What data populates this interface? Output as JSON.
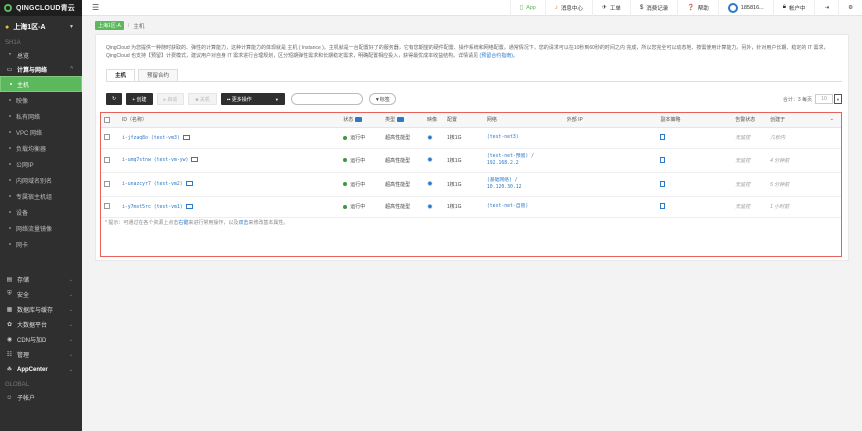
{
  "brand": {
    "logo_text": "QINGCLOUD青云"
  },
  "sidebar": {
    "zone_label": "上海1区-A",
    "section_label": "SH1A",
    "global_label": "GLOBAL",
    "items_top": [
      {
        "label": "总览",
        "icon": "dashboard-icon",
        "glyph": "◔"
      },
      {
        "label": "计算与网络",
        "icon": "computer-icon",
        "glyph": "▭"
      }
    ],
    "sub_items": [
      "主机",
      "映像",
      "私有网络",
      "VPC 网络",
      "负载均衡器",
      "公网IP",
      "内网域名别名",
      "专属宿主机组",
      "设备",
      "网络流量镜像",
      "网卡"
    ],
    "items_bottom": [
      {
        "label": "存储",
        "icon": "storage-icon",
        "glyph": "▤"
      },
      {
        "label": "安全",
        "icon": "security-icon",
        "glyph": "⛨"
      },
      {
        "label": "数据库与缓存",
        "icon": "database-icon",
        "glyph": "▦"
      },
      {
        "label": "大数据平台",
        "icon": "bigdata-icon",
        "glyph": "✿"
      },
      {
        "label": "CDN与加D",
        "icon": "cdn-icon",
        "glyph": "◉"
      },
      {
        "label": "管理",
        "icon": "manage-icon",
        "glyph": "☷"
      },
      {
        "label": "AppCenter",
        "icon": "appcenter-icon",
        "glyph": "☘"
      }
    ],
    "account_item": {
      "label": "子帐户",
      "icon": "users-icon",
      "glyph": "☺"
    }
  },
  "topbar": {
    "items": [
      {
        "label": "App",
        "icon": "app-icon",
        "glyph": "▯"
      },
      {
        "label": "消息中心",
        "icon": "bell-icon",
        "glyph": "♪"
      },
      {
        "label": "工单",
        "icon": "ticket-icon",
        "glyph": "✈"
      },
      {
        "label": "消费记录",
        "icon": "dollar-icon",
        "glyph": "$"
      },
      {
        "label": "帮助",
        "icon": "help-icon",
        "glyph": "❓"
      }
    ],
    "user_label": "185816...",
    "account_label": "帐户中",
    "account_icon": "lock-icon",
    "exit_glyph": "⇥",
    "settings_glyph": "⚙"
  },
  "breadcrumb": {
    "zone": "上海1区-A",
    "page": "主机"
  },
  "description": {
    "text_1": "QingCloud 为您提供一种随时获取的、弹性的计算能力，这种计算能力的体现就是 主机 ( Instance )。主机就是一台配置好了的服务器，它有您期望的硬件配置、操作系统和网络配置。通常情况下，您的请求可以在10秒到60秒的时间之内 完成，所以您完全可以动态地、按需使用计算能力。另外，针对用户长期、稳定的 IT 需求，QingCloud 也支持【预留】计费模式，建议用户对自身 IT 需求进行合理规划，区分短期弹性需求和长期稳定需求，明确配置相应投入，获得最优成本收益结构。详情请见",
    "link_text": "(预留合约指南)",
    "text_2": "。"
  },
  "tabs": [
    {
      "label": "主机"
    },
    {
      "label": "预留合约"
    }
  ],
  "toolbar": {
    "refresh_glyph": "↻",
    "create_label": "+ 创建",
    "start_label": "▸ 启动",
    "stop_label": "■ 关机",
    "more_label": "▪▪ 更多操作",
    "tag_label": "▼标签",
    "pager_text": "合计：3 每页",
    "page_size": "10"
  },
  "table": {
    "headers": [
      "ID（名称）",
      "状态",
      "类型",
      "映像",
      "配置",
      "网络",
      "外部 IP",
      "副本策略",
      "告警状态",
      "创建于"
    ],
    "rows": [
      {
        "id": "i-jfzaq8o (test-vm3)",
        "status": "运行中",
        "type": "超高性能型",
        "config": "1核1G",
        "network": "(test-net3)",
        "network2": "",
        "alarm": "无监控",
        "created": "几秒内",
        "policy_icon": "copy-icon"
      },
      {
        "id": "i-umq7stnw (test-vm-yw)",
        "status": "运行中",
        "type": "超高性能型",
        "config": "1核1G",
        "network": "(test-net-预留) /",
        "network2": "192.168.2.2",
        "alarm": "无监控",
        "created": "4 分钟前",
        "policy_icon": "copy-icon"
      },
      {
        "id": "i-unazcyr7 (test-vm2)",
        "status": "运行中",
        "type": "超高性能型",
        "config": "1核1G",
        "network": "(基础网络) /",
        "network2": "10.120.30.12",
        "alarm": "无监控",
        "created": "5 分钟前",
        "policy_icon": "copy-icon"
      },
      {
        "id": "i-y7mxt5rc (test-vm1)",
        "status": "运行中",
        "type": "超高性能型",
        "config": "1核1G",
        "network": "(test-net-自管)",
        "network2": "",
        "alarm": "无监控",
        "created": "1 小时前",
        "policy_icon": "doc-icon"
      }
    ],
    "hint_1": "* 提示：可通过在各个资源上点击",
    "hint_link_1": "右键",
    "hint_2": "来进行常用操作，以及",
    "hint_link_2": "双击",
    "hint_3": "来修改基本属性。"
  }
}
